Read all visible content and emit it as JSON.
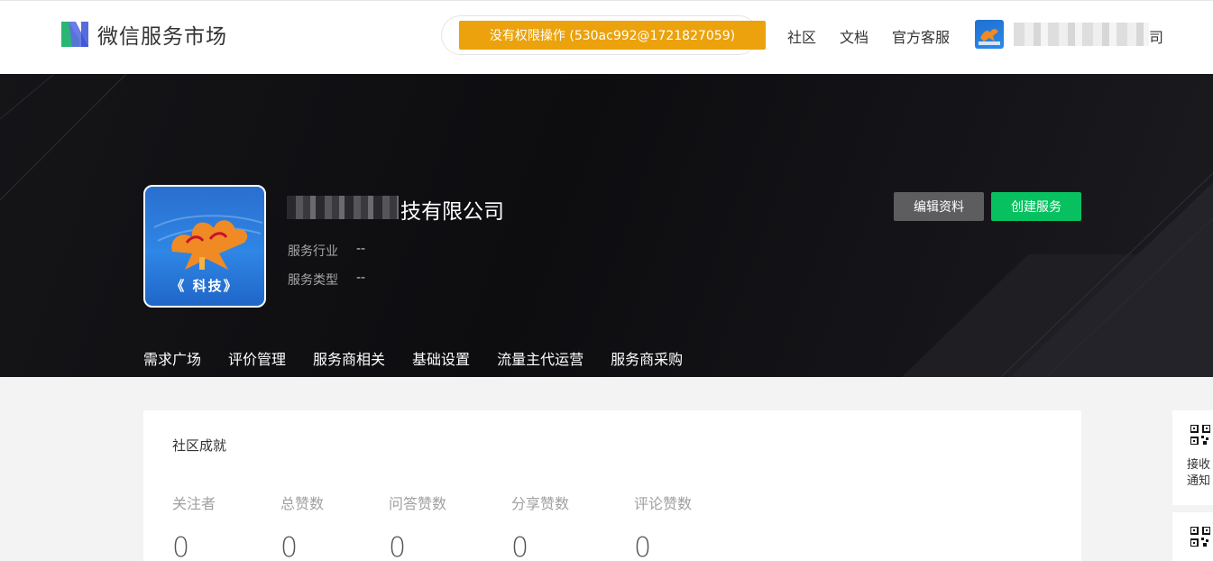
{
  "header": {
    "logo_text": "微信服务市场",
    "warning": "没有权限操作 (530ac992@1721827059)",
    "nav": [
      "社区",
      "文档",
      "官方客服"
    ],
    "user_name_visible": "司"
  },
  "profile": {
    "company_visible": "技有限公司",
    "avatar_caption": "《 科技》",
    "industry_label": "服务行业",
    "industry_value": "--",
    "type_label": "服务类型",
    "type_value": "--",
    "edit_button": "编辑资料",
    "create_button": "创建服务"
  },
  "tabs": [
    "需求广场",
    "评价管理",
    "服务商相关",
    "基础设置",
    "流量主代运营",
    "服务商采购"
  ],
  "community": {
    "title": "社区成就",
    "stats": [
      {
        "label": "关注者",
        "value": "0"
      },
      {
        "label": "总赞数",
        "value": "0"
      },
      {
        "label": "问答赞数",
        "value": "0"
      },
      {
        "label": "分享赞数",
        "value": "0"
      },
      {
        "label": "评论赞数",
        "value": "0"
      }
    ]
  },
  "side": {
    "notify_line1": "接收",
    "notify_line2": "通知"
  },
  "colors": {
    "warning_bg": "#eba20c",
    "create_green": "#07c160",
    "edit_gray": "#5d5d60"
  }
}
